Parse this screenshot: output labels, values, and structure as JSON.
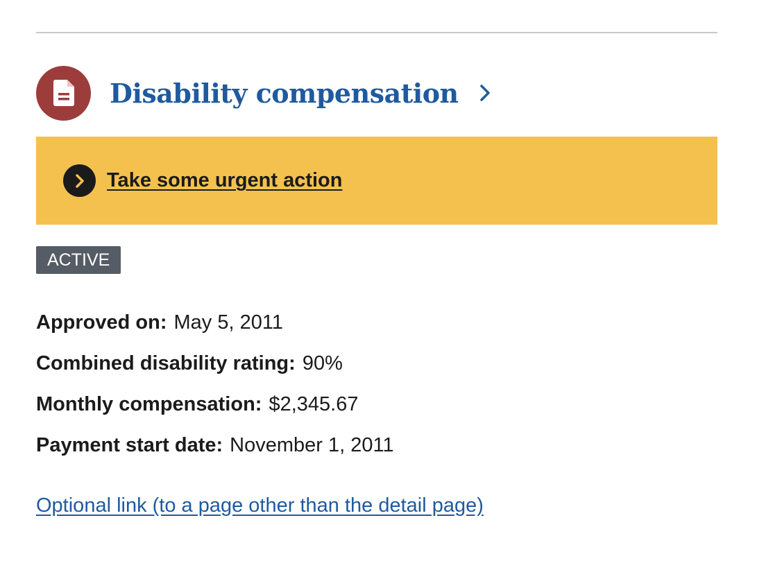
{
  "card": {
    "title": "Disability compensation",
    "title_icon": "document-icon",
    "accent_color": "#9c3d3c",
    "link_color": "#1f5a9e"
  },
  "alert": {
    "text": "Take some urgent action",
    "icon": "chevron-right-circle-icon",
    "background": "#f4c14f"
  },
  "status": {
    "label": "ACTIVE"
  },
  "details": [
    {
      "label": "Approved on:",
      "value": "May 5, 2011"
    },
    {
      "label": "Combined disability rating:",
      "value": "90%"
    },
    {
      "label": "Monthly compensation:",
      "value": "$2,345.67"
    },
    {
      "label": "Payment start date:",
      "value": "November 1, 2011"
    }
  ],
  "footer_link": {
    "text": "Optional link (to a page other than the detail page)"
  }
}
